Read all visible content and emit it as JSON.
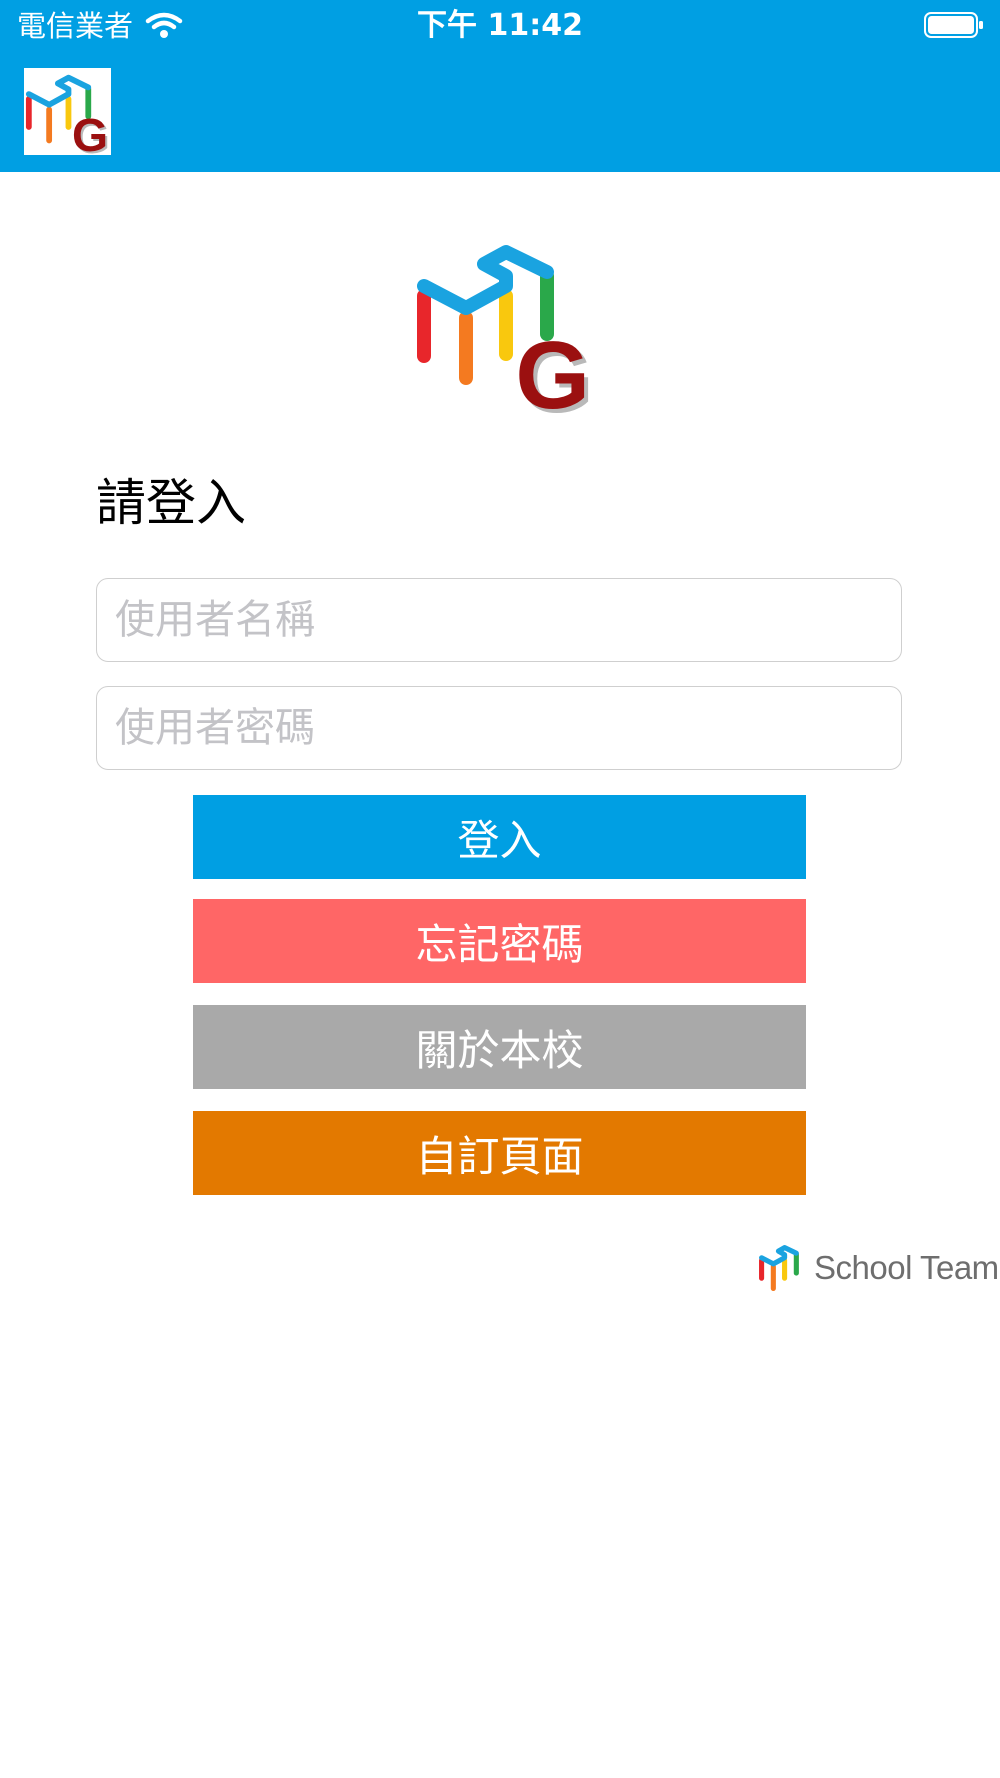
{
  "status_bar": {
    "carrier": "電信業者",
    "time": "下午 11:42",
    "icons": [
      "wifi-icon",
      "battery-icon"
    ]
  },
  "nav_bar": {
    "logo": "app-logo"
  },
  "login": {
    "title": "請登入",
    "username_placeholder": "使用者名稱",
    "password_placeholder": "使用者密碼",
    "username_value": "",
    "password_value": ""
  },
  "buttons": {
    "login": "登入",
    "forgot_password": "忘記密碼",
    "about_school": "關於本校",
    "custom_page": "自訂頁面"
  },
  "footer": {
    "brand": "School Team"
  },
  "colors": {
    "header_blue": "#009fe3",
    "login_button": "#009fe3",
    "forgot_button": "#ff6666",
    "about_button": "#a9a9a9",
    "custom_button": "#e37900",
    "logo_g": "#9b1010"
  }
}
